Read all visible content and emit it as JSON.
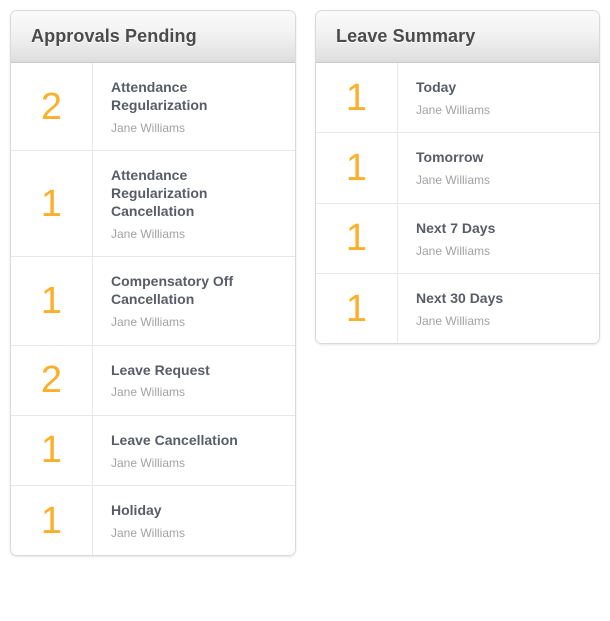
{
  "theme": {
    "accent_color": "#fbaf2a",
    "title_color": "#4b4b4b",
    "label_color": "#575c66",
    "person_color": "#a2a2a2",
    "card_border_color": "#d9d9d9",
    "row_divider_color": "#e8e8e8",
    "page_background": "#ffffff"
  },
  "cards": [
    {
      "id": "approvals-pending",
      "title": "Approvals Pending",
      "rows": [
        {
          "count": "2",
          "label": "Attendance Regularization",
          "person": "Jane Williams"
        },
        {
          "count": "1",
          "label": "Attendance Regularization Cancellation",
          "person": "Jane Williams"
        },
        {
          "count": "1",
          "label": "Compensatory Off Cancellation",
          "person": "Jane Williams"
        },
        {
          "count": "2",
          "label": "Leave Request",
          "person": "Jane Williams"
        },
        {
          "count": "1",
          "label": "Leave Cancellation",
          "person": "Jane Williams"
        },
        {
          "count": "1",
          "label": "Holiday",
          "person": "Jane Williams"
        }
      ]
    },
    {
      "id": "leave-summary",
      "title": "Leave Summary",
      "rows": [
        {
          "count": "1",
          "label": "Today",
          "person": "Jane Williams"
        },
        {
          "count": "1",
          "label": "Tomorrow",
          "person": "Jane Williams"
        },
        {
          "count": "1",
          "label": "Next 7 Days",
          "person": "Jane Williams"
        },
        {
          "count": "1",
          "label": "Next 30 Days",
          "person": "Jane Williams"
        }
      ]
    }
  ]
}
